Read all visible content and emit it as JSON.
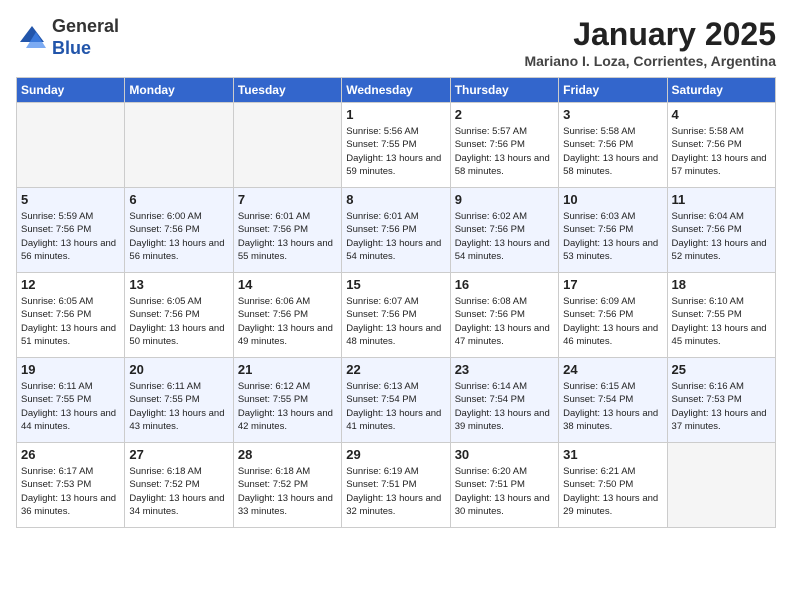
{
  "logo": {
    "general": "General",
    "blue": "Blue"
  },
  "title": "January 2025",
  "location": "Mariano I. Loza, Corrientes, Argentina",
  "days_of_week": [
    "Sunday",
    "Monday",
    "Tuesday",
    "Wednesday",
    "Thursday",
    "Friday",
    "Saturday"
  ],
  "weeks": [
    [
      {
        "day": "",
        "empty": true
      },
      {
        "day": "",
        "empty": true
      },
      {
        "day": "",
        "empty": true
      },
      {
        "day": "1",
        "sunrise": "Sunrise: 5:56 AM",
        "sunset": "Sunset: 7:55 PM",
        "daylight": "Daylight: 13 hours and 59 minutes."
      },
      {
        "day": "2",
        "sunrise": "Sunrise: 5:57 AM",
        "sunset": "Sunset: 7:56 PM",
        "daylight": "Daylight: 13 hours and 58 minutes."
      },
      {
        "day": "3",
        "sunrise": "Sunrise: 5:58 AM",
        "sunset": "Sunset: 7:56 PM",
        "daylight": "Daylight: 13 hours and 58 minutes."
      },
      {
        "day": "4",
        "sunrise": "Sunrise: 5:58 AM",
        "sunset": "Sunset: 7:56 PM",
        "daylight": "Daylight: 13 hours and 57 minutes."
      }
    ],
    [
      {
        "day": "5",
        "sunrise": "Sunrise: 5:59 AM",
        "sunset": "Sunset: 7:56 PM",
        "daylight": "Daylight: 13 hours and 56 minutes."
      },
      {
        "day": "6",
        "sunrise": "Sunrise: 6:00 AM",
        "sunset": "Sunset: 7:56 PM",
        "daylight": "Daylight: 13 hours and 56 minutes."
      },
      {
        "day": "7",
        "sunrise": "Sunrise: 6:01 AM",
        "sunset": "Sunset: 7:56 PM",
        "daylight": "Daylight: 13 hours and 55 minutes."
      },
      {
        "day": "8",
        "sunrise": "Sunrise: 6:01 AM",
        "sunset": "Sunset: 7:56 PM",
        "daylight": "Daylight: 13 hours and 54 minutes."
      },
      {
        "day": "9",
        "sunrise": "Sunrise: 6:02 AM",
        "sunset": "Sunset: 7:56 PM",
        "daylight": "Daylight: 13 hours and 54 minutes."
      },
      {
        "day": "10",
        "sunrise": "Sunrise: 6:03 AM",
        "sunset": "Sunset: 7:56 PM",
        "daylight": "Daylight: 13 hours and 53 minutes."
      },
      {
        "day": "11",
        "sunrise": "Sunrise: 6:04 AM",
        "sunset": "Sunset: 7:56 PM",
        "daylight": "Daylight: 13 hours and 52 minutes."
      }
    ],
    [
      {
        "day": "12",
        "sunrise": "Sunrise: 6:05 AM",
        "sunset": "Sunset: 7:56 PM",
        "daylight": "Daylight: 13 hours and 51 minutes."
      },
      {
        "day": "13",
        "sunrise": "Sunrise: 6:05 AM",
        "sunset": "Sunset: 7:56 PM",
        "daylight": "Daylight: 13 hours and 50 minutes."
      },
      {
        "day": "14",
        "sunrise": "Sunrise: 6:06 AM",
        "sunset": "Sunset: 7:56 PM",
        "daylight": "Daylight: 13 hours and 49 minutes."
      },
      {
        "day": "15",
        "sunrise": "Sunrise: 6:07 AM",
        "sunset": "Sunset: 7:56 PM",
        "daylight": "Daylight: 13 hours and 48 minutes."
      },
      {
        "day": "16",
        "sunrise": "Sunrise: 6:08 AM",
        "sunset": "Sunset: 7:56 PM",
        "daylight": "Daylight: 13 hours and 47 minutes."
      },
      {
        "day": "17",
        "sunrise": "Sunrise: 6:09 AM",
        "sunset": "Sunset: 7:56 PM",
        "daylight": "Daylight: 13 hours and 46 minutes."
      },
      {
        "day": "18",
        "sunrise": "Sunrise: 6:10 AM",
        "sunset": "Sunset: 7:55 PM",
        "daylight": "Daylight: 13 hours and 45 minutes."
      }
    ],
    [
      {
        "day": "19",
        "sunrise": "Sunrise: 6:11 AM",
        "sunset": "Sunset: 7:55 PM",
        "daylight": "Daylight: 13 hours and 44 minutes."
      },
      {
        "day": "20",
        "sunrise": "Sunrise: 6:11 AM",
        "sunset": "Sunset: 7:55 PM",
        "daylight": "Daylight: 13 hours and 43 minutes."
      },
      {
        "day": "21",
        "sunrise": "Sunrise: 6:12 AM",
        "sunset": "Sunset: 7:55 PM",
        "daylight": "Daylight: 13 hours and 42 minutes."
      },
      {
        "day": "22",
        "sunrise": "Sunrise: 6:13 AM",
        "sunset": "Sunset: 7:54 PM",
        "daylight": "Daylight: 13 hours and 41 minutes."
      },
      {
        "day": "23",
        "sunrise": "Sunrise: 6:14 AM",
        "sunset": "Sunset: 7:54 PM",
        "daylight": "Daylight: 13 hours and 39 minutes."
      },
      {
        "day": "24",
        "sunrise": "Sunrise: 6:15 AM",
        "sunset": "Sunset: 7:54 PM",
        "daylight": "Daylight: 13 hours and 38 minutes."
      },
      {
        "day": "25",
        "sunrise": "Sunrise: 6:16 AM",
        "sunset": "Sunset: 7:53 PM",
        "daylight": "Daylight: 13 hours and 37 minutes."
      }
    ],
    [
      {
        "day": "26",
        "sunrise": "Sunrise: 6:17 AM",
        "sunset": "Sunset: 7:53 PM",
        "daylight": "Daylight: 13 hours and 36 minutes."
      },
      {
        "day": "27",
        "sunrise": "Sunrise: 6:18 AM",
        "sunset": "Sunset: 7:52 PM",
        "daylight": "Daylight: 13 hours and 34 minutes."
      },
      {
        "day": "28",
        "sunrise": "Sunrise: 6:18 AM",
        "sunset": "Sunset: 7:52 PM",
        "daylight": "Daylight: 13 hours and 33 minutes."
      },
      {
        "day": "29",
        "sunrise": "Sunrise: 6:19 AM",
        "sunset": "Sunset: 7:51 PM",
        "daylight": "Daylight: 13 hours and 32 minutes."
      },
      {
        "day": "30",
        "sunrise": "Sunrise: 6:20 AM",
        "sunset": "Sunset: 7:51 PM",
        "daylight": "Daylight: 13 hours and 30 minutes."
      },
      {
        "day": "31",
        "sunrise": "Sunrise: 6:21 AM",
        "sunset": "Sunset: 7:50 PM",
        "daylight": "Daylight: 13 hours and 29 minutes."
      },
      {
        "day": "",
        "empty": true
      }
    ]
  ]
}
